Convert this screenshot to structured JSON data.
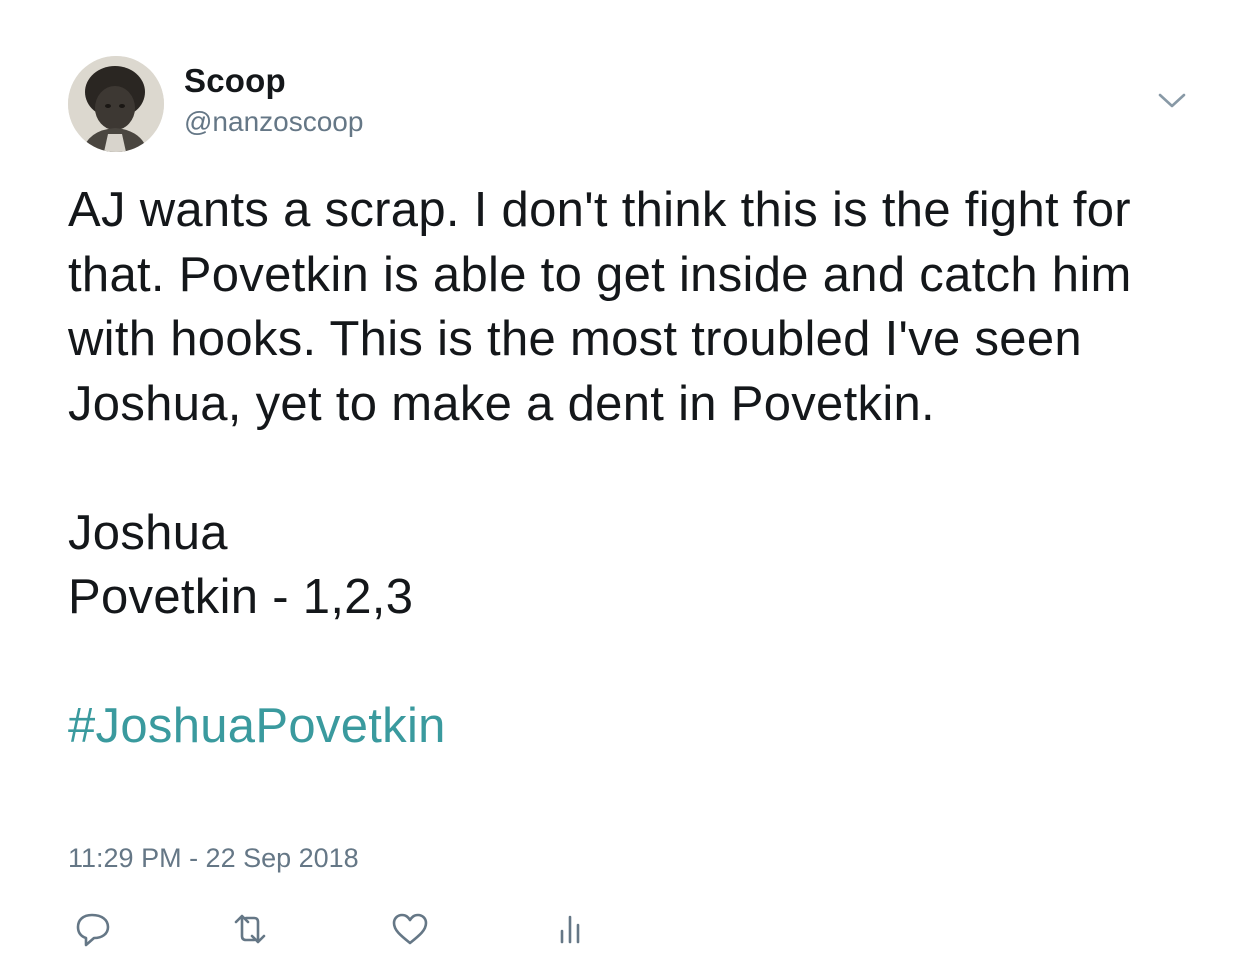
{
  "author": {
    "display_name": "Scoop",
    "handle": "@nanzoscoop"
  },
  "tweet": {
    "paragraph_1": "AJ wants a scrap. I don't think this is the fight for that. Povetkin is able to get inside and catch him with hooks. This is the most troubled I've seen Joshua, yet to make a dent in Povetkin.",
    "line_2": "Joshua",
    "line_3": "Povetkin - 1,2,3",
    "hashtag": "#JoshuaPovetkin",
    "timestamp": "11:29 PM - 22 Sep 2018"
  },
  "icons": {
    "menu": "chevron-down-icon",
    "reply": "reply-bubble-icon",
    "retweet": "retweet-icon",
    "like": "heart-icon",
    "analytics": "bar-chart-icon"
  },
  "colors": {
    "text": "#14171a",
    "secondary": "#657786",
    "hashtag": "#3a9a9e"
  }
}
